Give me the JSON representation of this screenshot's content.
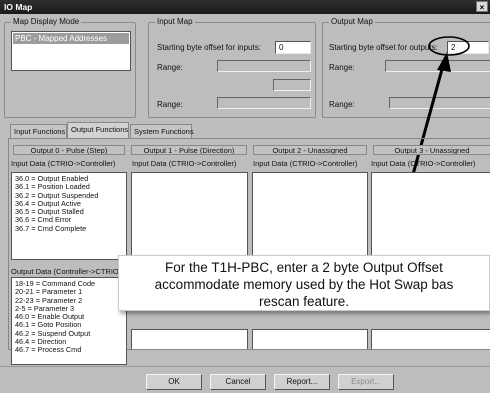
{
  "window": {
    "title": "IO Map",
    "close_label": "×"
  },
  "map_display_mode": {
    "group_label": "Map Display Mode",
    "selected_item": "PBC - Mapped Addresses"
  },
  "input_map": {
    "group_label": "Input Map",
    "offset_label": "Starting byte offset for inputs:",
    "offset_value": "0",
    "range_label_1": "Range:",
    "range_label_2": "Range:"
  },
  "output_map": {
    "group_label": "Output Map",
    "offset_label": "Starting byte offset for outputs:",
    "offset_value": "2",
    "range_label_1": "Range:",
    "range_label_2": "Range:"
  },
  "tabs": [
    {
      "label": "Input Functions"
    },
    {
      "label": "Output Functions"
    },
    {
      "label": "System Functions"
    }
  ],
  "columns": [
    {
      "header": "Output 0 - Pulse (Step)",
      "input_label": "Input Data (CTRIO->Controller)",
      "output_label": "Output Data (Controller->CTRIO)"
    },
    {
      "header": "Output 1 - Pulse (Direction)",
      "input_label": "Input Data (CTRIO->Controller)"
    },
    {
      "header": "Output 2 - Unassigned",
      "input_label": "Input Data (CTRIO->Controller)"
    },
    {
      "header": "Output 3 - Unassigned",
      "input_label": "Input Data (CTRIO->Controller)"
    }
  ],
  "input_items": [
    "36.0 = Output Enabled",
    "36.1 = Position Loaded",
    "36.2 = Output Suspended",
    "36.4 = Output Active",
    "36.5 = Output Stalled",
    "36.6 = Cmd Error",
    "36.7 = Cmd Complete"
  ],
  "output_items": [
    "18-19 = Command Code",
    "20-21 = Parameter 1",
    "22-23 = Parameter 2",
    "2-5 = Parameter 3",
    "46.0 = Enable Output",
    "46.1 = Goto Position",
    "46.2 = Suspend Output",
    "46.4 = Direction",
    "46.7 = Process Cmd"
  ],
  "callout": {
    "line1": "For the T1H-PBC, enter a 2 byte Output Offset",
    "line2": "accommodate memory used by the Hot Swap bas",
    "line3": "rescan feature."
  },
  "buttons": {
    "ok": "OK",
    "cancel": "Cancel",
    "report": "Report...",
    "export": "Export..."
  }
}
